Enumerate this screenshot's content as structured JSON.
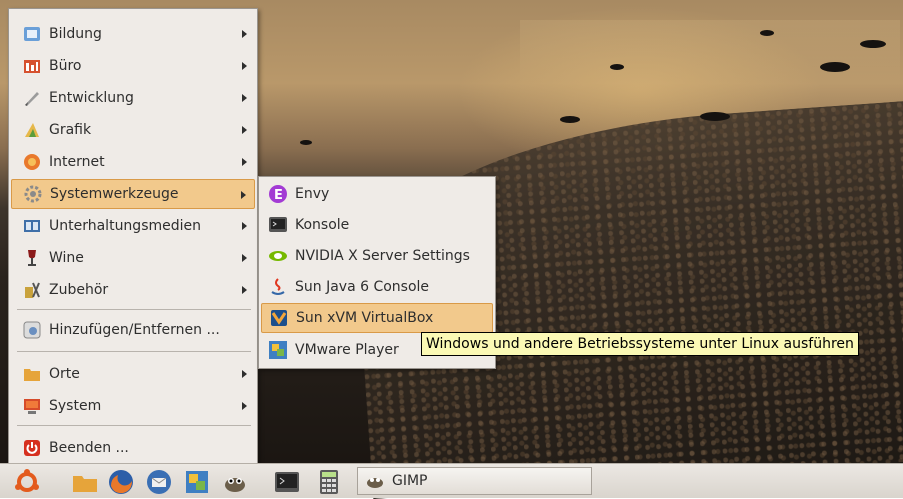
{
  "menu": {
    "items": [
      {
        "label": "Bildung",
        "icon": "education-icon"
      },
      {
        "label": "Büro",
        "icon": "office-icon"
      },
      {
        "label": "Entwicklung",
        "icon": "development-icon"
      },
      {
        "label": "Grafik",
        "icon": "graphics-icon"
      },
      {
        "label": "Internet",
        "icon": "internet-icon"
      },
      {
        "label": "Systemwerkzeuge",
        "icon": "gear-icon"
      },
      {
        "label": "Unterhaltungsmedien",
        "icon": "multimedia-icon"
      },
      {
        "label": "Wine",
        "icon": "wine-icon"
      },
      {
        "label": "Zubehör",
        "icon": "accessories-icon"
      },
      {
        "label": "Hinzufügen/Entfernen ...",
        "icon": "add-remove-icon"
      },
      {
        "label": "Orte",
        "icon": "folder-icon"
      },
      {
        "label": "System",
        "icon": "monitor-icon"
      },
      {
        "label": "Beenden ...",
        "icon": "power-icon"
      }
    ]
  },
  "submenu": {
    "items": [
      {
        "label": "Envy",
        "icon": "envy-icon"
      },
      {
        "label": "Konsole",
        "icon": "terminal-icon"
      },
      {
        "label": "NVIDIA X Server Settings",
        "icon": "nvidia-icon"
      },
      {
        "label": "Sun Java 6 Console",
        "icon": "java-icon"
      },
      {
        "label": "Sun xVM VirtualBox",
        "icon": "virtualbox-icon"
      },
      {
        "label": "VMware Player",
        "icon": "vmware-icon"
      }
    ]
  },
  "tooltip": {
    "text": "Windows und andere Betriebssysteme unter Linux ausführen"
  },
  "taskbar": {
    "window_label": "GIMP"
  },
  "colors": {
    "highlight": "#f2c98c",
    "highlight_border": "#d99a48",
    "tooltip_bg": "#fbf9b5"
  }
}
